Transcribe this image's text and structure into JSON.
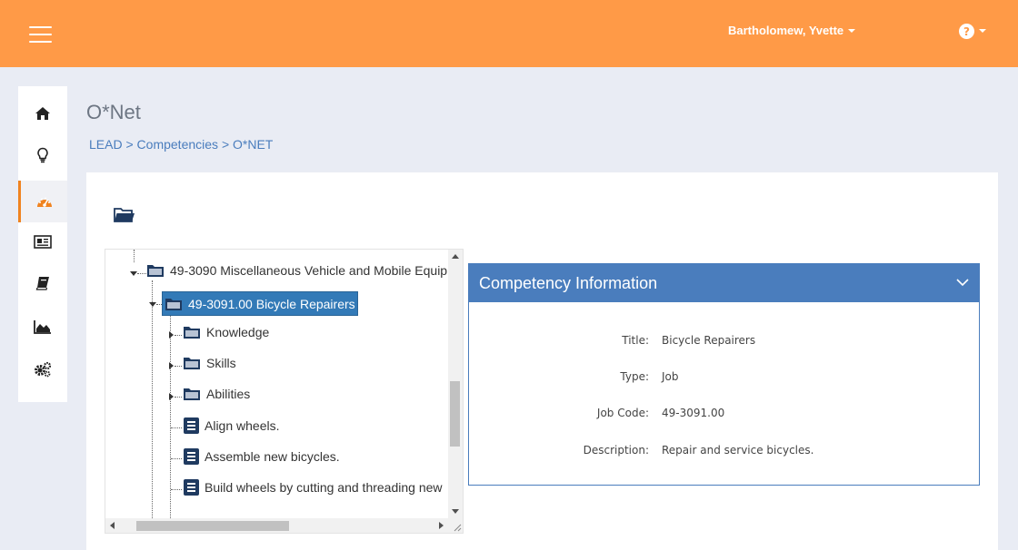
{
  "header": {
    "user_name": "Bartholomew, Yvette",
    "help_glyph": "?",
    "background_color": "#ff9a47"
  },
  "sidebar": {
    "items": [
      {
        "icon": "home-icon",
        "active": false
      },
      {
        "icon": "lightbulb-icon",
        "active": false
      },
      {
        "icon": "dashboard-icon",
        "active": true
      },
      {
        "icon": "newspaper-icon",
        "active": false
      },
      {
        "icon": "book-icon",
        "active": false
      },
      {
        "icon": "area-chart-icon",
        "active": false
      },
      {
        "icon": "settings-gears-icon",
        "active": false
      }
    ]
  },
  "page": {
    "title": "O*Net",
    "breadcrumb": [
      {
        "label": "LEAD"
      },
      {
        "label": "Competencies"
      },
      {
        "label": "O*NET"
      }
    ],
    "breadcrumb_separator": ">"
  },
  "tree": {
    "nodes": [
      {
        "label": "49-3090 Miscellaneous Vehicle and Mobile Equip",
        "type": "folder",
        "expanded": true
      },
      {
        "label": "49-3091.00 Bicycle Repairers",
        "type": "folder",
        "expanded": true,
        "selected": true
      },
      {
        "label": "Knowledge",
        "type": "folder",
        "expanded": false
      },
      {
        "label": "Skills",
        "type": "folder",
        "expanded": false
      },
      {
        "label": "Abilities",
        "type": "folder",
        "expanded": false
      },
      {
        "label": "Align wheels.",
        "type": "item"
      },
      {
        "label": "Assemble new bicycles.",
        "type": "item"
      },
      {
        "label": "Build wheels by cutting and threading new",
        "type": "item"
      }
    ]
  },
  "competency": {
    "header": "Competency Information",
    "fields": [
      {
        "label": "Title:",
        "value": "Bicycle Repairers"
      },
      {
        "label": "Type:",
        "value": "Job"
      },
      {
        "label": "Job Code:",
        "value": "49-3091.00"
      },
      {
        "label": "Description:",
        "value": "Repair and service bicycles."
      }
    ],
    "accent_color": "#4a7dbd"
  }
}
